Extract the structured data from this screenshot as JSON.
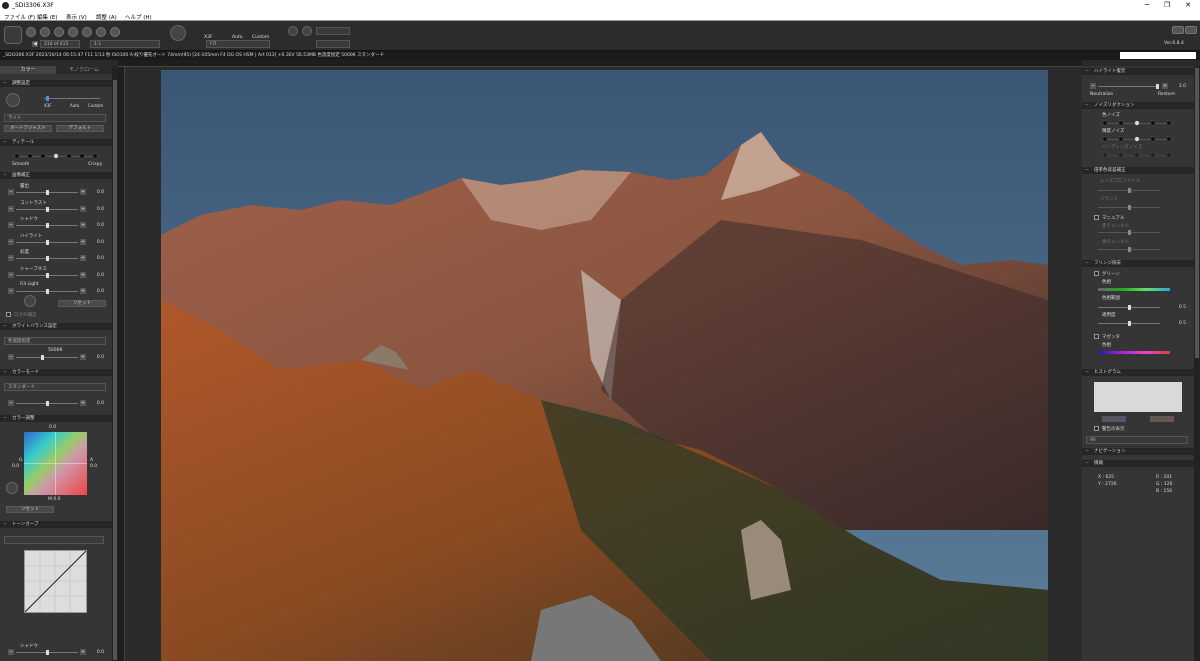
{
  "window": {
    "title": "_SDI3306.X3F",
    "minimize": "─",
    "maximize": "❐",
    "close": "✕"
  },
  "menu": [
    "ファイル (F)",
    "編集 (E)",
    "表示 (V)",
    "調整 (A)",
    "ヘルプ (H)"
  ],
  "toolbar": {
    "counter": "210 of 415",
    "zoom_left": "1:1",
    "mode_labels": {
      "x3f": "X3F",
      "auto": "Auto",
      "custom": "Custom",
      "fit": "FIT"
    },
    "version": "Ver.6.8.4"
  },
  "infobar": {
    "text": "_SDI3306.X3F 2023/10/14 06:15:47 F11 1/13 秒 ISO100 A-絞り優先オート 74mm(95) [24-105mm F4 DG OS HSM | Art 013] +0.3EV 56.53MB 色温度指定 5000K スタンダード"
  },
  "left_panel": {
    "tabs": [
      "カラー",
      "モノクローム"
    ],
    "adjust_mode": {
      "title": "調整設定",
      "labels": [
        "X3F",
        "Auto",
        "Custom"
      ],
      "preset": "ライト",
      "btn_left": "オートアジャスト",
      "btn_right": "デフォルト"
    },
    "detail": {
      "title": "ディテール",
      "left": "Smooth",
      "right": "Crispy"
    },
    "image_correction": {
      "title": "画像補正",
      "rows": [
        {
          "label": "露出",
          "value": "0.0"
        },
        {
          "label": "コントラスト",
          "value": "0.0"
        },
        {
          "label": "シャドウ",
          "value": "0.0"
        },
        {
          "label": "ハイライト",
          "value": "0.0"
        },
        {
          "label": "彩度",
          "value": "0.0"
        },
        {
          "label": "シャープネス",
          "value": "0.0"
        },
        {
          "label": "Fill Light",
          "value": "0.0"
        }
      ],
      "reset": "リセット",
      "auto_check": "ログの補正"
    },
    "white_balance": {
      "title": "ホワイトバランス設定",
      "mode": "色温度指定",
      "temp": "5000K",
      "value": "0.0"
    },
    "color_mode": {
      "title": "カラーモード",
      "mode": "スタンダード",
      "value": "0.0"
    },
    "color_adjust": {
      "title": "カラー調整",
      "top": "0.0",
      "g_label": "G",
      "a_label": "A",
      "left_val": "0.0",
      "right_val": "0.0",
      "bottom": "M 0.0",
      "reset": "リセット"
    },
    "tone_curve": {
      "title": "トーンカーブ",
      "shadow_label": "シャドウ",
      "value": "0.0"
    }
  },
  "right_panel": {
    "highlight": {
      "title": "ハイライト復元",
      "neutralize": "Neutralize",
      "restore": "Restore",
      "value": "1.0"
    },
    "noise": {
      "title": "ノイズリダクション",
      "rows": [
        "色ノイズ",
        "輝度ノイズ",
        "バンディングノイズ"
      ]
    },
    "lens": {
      "title": "倍率色収差補正",
      "rows": [
        "レンズプロファイル",
        "バランス"
      ],
      "manual": "マニュアル",
      "manual_rows": [
        "赤チャンネル",
        "青チャンネル"
      ]
    },
    "fringe": {
      "title": "フリンジ除去",
      "green": "グリーン",
      "hue": "色相",
      "width_label": "色相範囲",
      "width_val": "0.5",
      "sat_label": "適用度",
      "sat_val": "0.5",
      "magenta": "マゼンタ",
      "hue2": "色相"
    },
    "histogram": {
      "title": "ヒストグラム",
      "warning": "警告の表示",
      "channel": "All"
    },
    "navigation": {
      "title": "ナビゲーション"
    },
    "info": {
      "title": "情報",
      "x": "X : 625",
      "y": "Y : 2726",
      "r": "R : 101",
      "g": "G : 126",
      "b": "B : 156"
    }
  },
  "colors": {
    "accent": "#4a8fd8",
    "sky": "#3c5a78"
  }
}
